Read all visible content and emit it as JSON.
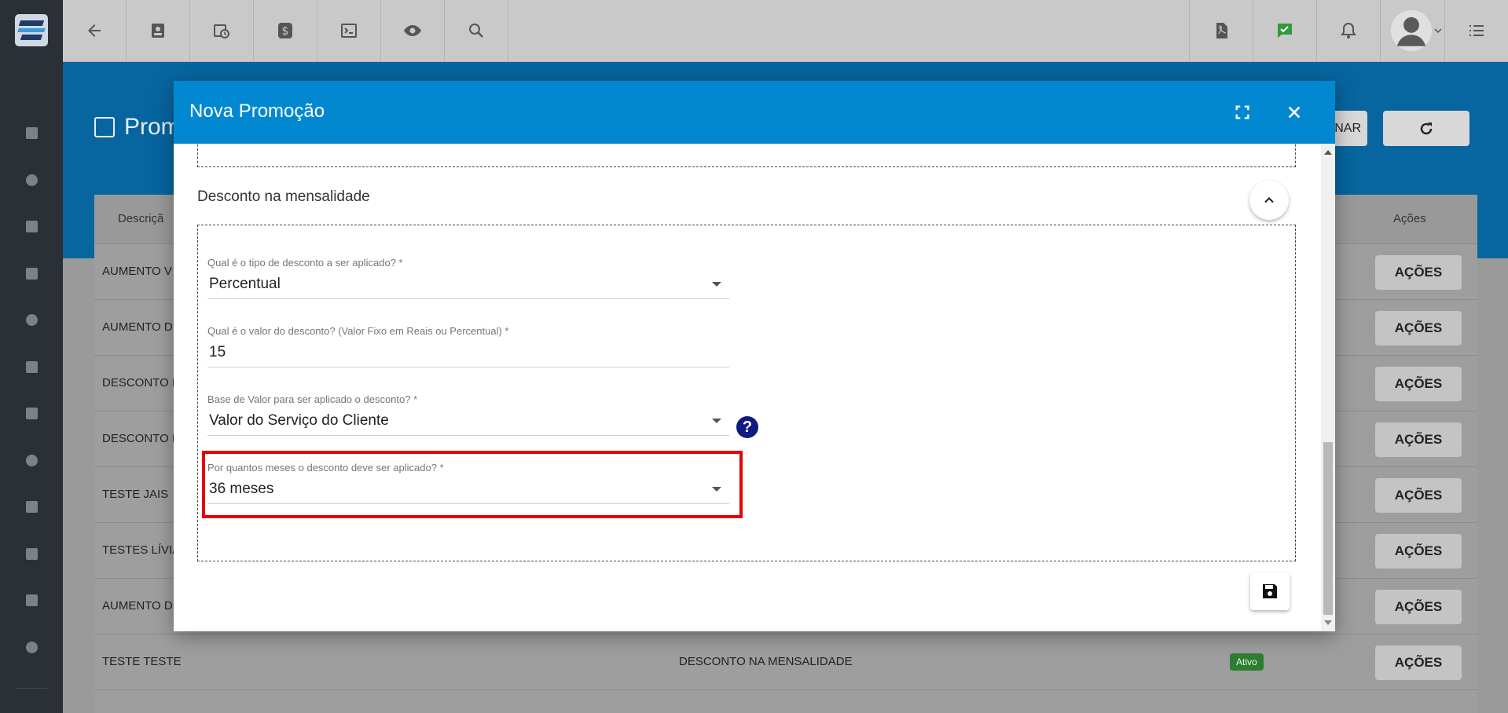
{
  "topbar": {
    "icons": [
      "back-arrow-icon",
      "contact-card-icon",
      "calendar-clock-icon",
      "dollar-icon",
      "terminal-icon",
      "eye-icon",
      "search-icon",
      "pdf-icon",
      "chat-check-icon",
      "bell-icon",
      "user-avatar-icon",
      "list-menu-icon"
    ]
  },
  "sidebar": {
    "icons": [
      "dashboard-icon",
      "pie-chart-icon",
      "contact-icon",
      "board-icon",
      "calendar-icon",
      "box-icon",
      "money-icon",
      "location-icon",
      "list-icon",
      "server-icon",
      "document-icon",
      "settings-icon"
    ]
  },
  "page": {
    "title": "Prom",
    "hidden_button_label": "NAR"
  },
  "table": {
    "header_desc": "Descriçã",
    "header_acoes": "Ações",
    "action_label": "AÇÕES",
    "rows": [
      {
        "desc": "AUMENTO V",
        "type": "",
        "status": ""
      },
      {
        "desc": "AUMENTO D",
        "type": "",
        "status": ""
      },
      {
        "desc": "DESCONTO F",
        "type": "",
        "status": ""
      },
      {
        "desc": "DESCONTO N",
        "type": "",
        "status": ""
      },
      {
        "desc": "TESTE JAIS",
        "type": "",
        "status": ""
      },
      {
        "desc": "TESTES LÍVIA",
        "type": "",
        "status": ""
      },
      {
        "desc": "AUMENTO D",
        "type": "",
        "status": ""
      },
      {
        "desc": "TESTE TESTE",
        "type": "DESCONTO NA MENSALIDADE",
        "status": "Ativo"
      }
    ]
  },
  "modal": {
    "title": "Nova Promoção",
    "section_title": "Desconto na mensalidade",
    "fields": [
      {
        "label": "Qual é o tipo de desconto a ser aplicado? *",
        "value": "Percentual",
        "dropdown": true
      },
      {
        "label": "Qual é o valor do desconto? (Valor Fixo em Reais ou Percentual) *",
        "value": "15",
        "dropdown": false
      },
      {
        "label": "Base de Valor para ser aplicado o desconto? *",
        "value": "Valor do Serviço do Cliente",
        "dropdown": true
      },
      {
        "label": "Por quantos meses o desconto deve ser aplicado? *",
        "value": "36 meses",
        "dropdown": true
      }
    ],
    "help_label": "?"
  },
  "colors": {
    "modal_header": "#0288d1",
    "highlight": "#e60000",
    "badge_active": "#2e7d32"
  }
}
